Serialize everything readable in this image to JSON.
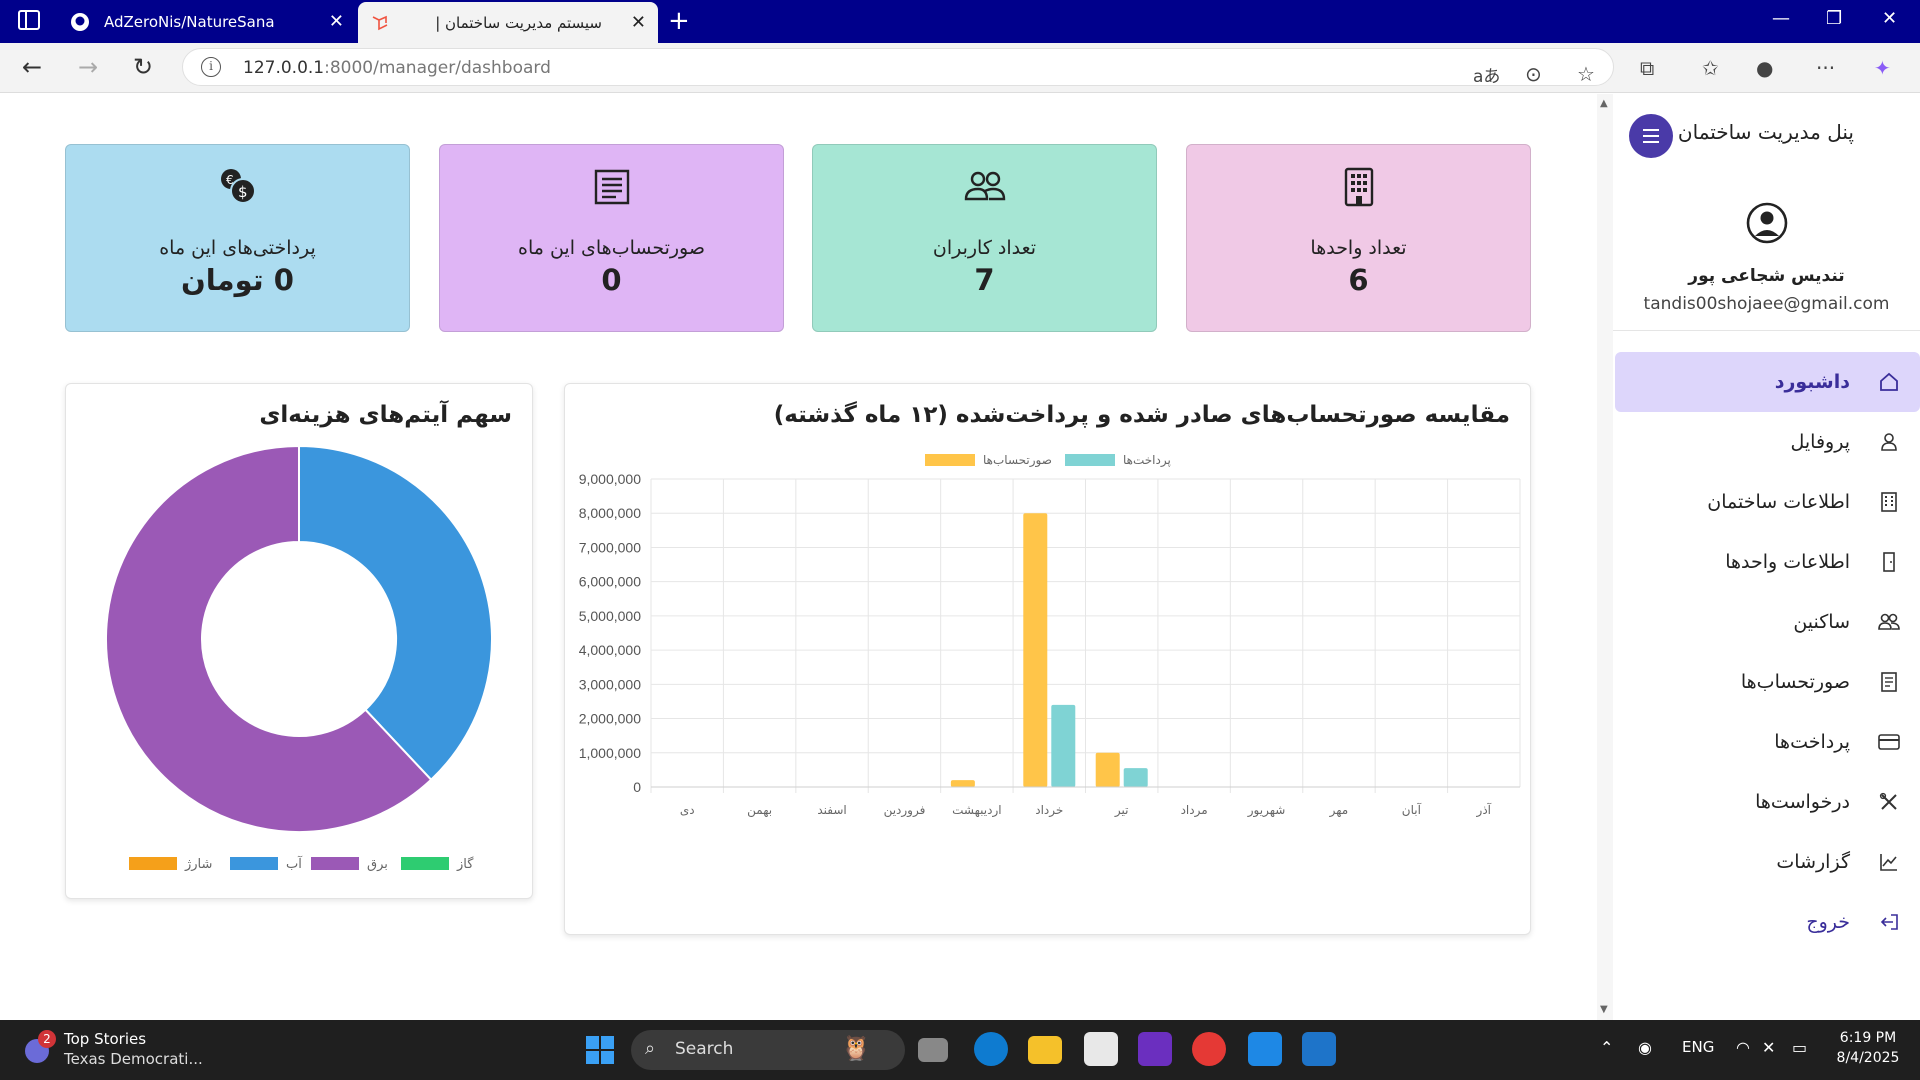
{
  "browser": {
    "tabs": [
      {
        "title": "AdZeroNis/NatureSana",
        "active": false
      },
      {
        "title": "سیستم مدیریت ساختمان |",
        "active": true
      }
    ],
    "url_host": "127.0.0.1",
    "url_path": ":8000/manager/dashboard"
  },
  "sidebar": {
    "brand": "پنل مدیریت ساختمان",
    "user_name": "تندیس شجاعی پور",
    "user_email": "tandis00shojaee@gmail.com",
    "items": [
      {
        "label": "داشبورد",
        "icon": "home-icon"
      },
      {
        "label": "پروفایل",
        "icon": "user-icon"
      },
      {
        "label": "اطلاعات ساختمان",
        "icon": "building-icon"
      },
      {
        "label": "اطلاعات واحدها",
        "icon": "door-icon"
      },
      {
        "label": "ساکنین",
        "icon": "people-icon"
      },
      {
        "label": "صورتحساب‌ها",
        "icon": "invoice-icon"
      },
      {
        "label": "پرداخت‌ها",
        "icon": "card-icon"
      },
      {
        "label": "درخواست‌ها",
        "icon": "tools-icon"
      },
      {
        "label": "گزارشات",
        "icon": "chart-icon"
      },
      {
        "label": "خروج",
        "icon": "logout-icon"
      }
    ]
  },
  "cards": {
    "units": {
      "label": "تعداد واحدها",
      "value": "6",
      "color": "#f0c9e6"
    },
    "users": {
      "label": "تعداد کاربران",
      "value": "7",
      "color": "#a6e6d4"
    },
    "invoices": {
      "label": "صورتحساب‌های این ماه",
      "value": "0",
      "color": "#dfb5f5"
    },
    "payments": {
      "label": "پرداختی‌های این ماه",
      "value": "0 تومان",
      "color": "#acdcf0"
    }
  },
  "bar_panel": {
    "title": "مقایسه صورتحساب‌های صادر شده و پرداخت‌شده (۱۲ ماه گذشته)"
  },
  "pie_panel": {
    "title": "سهم آیتم‌های هزینه‌ای"
  },
  "chart_data": [
    {
      "type": "bar",
      "categories": [
        "دی",
        "بهمن",
        "اسفند",
        "فروردین",
        "اردیبهشت",
        "خرداد",
        "تیر",
        "مرداد",
        "شهریور",
        "مهر",
        "آبان",
        "آذر"
      ],
      "series": [
        {
          "name": "صورتحساب‌ها",
          "color": "#ffc549",
          "values": [
            0,
            0,
            0,
            0,
            200000,
            8000000,
            1000000,
            0,
            0,
            0,
            0,
            0
          ]
        },
        {
          "name": "پرداخت‌ها",
          "color": "#7fd3d4",
          "values": [
            0,
            0,
            0,
            0,
            0,
            2400000,
            550000,
            0,
            0,
            0,
            0,
            0
          ]
        }
      ],
      "y_ticks": [
        "0",
        "1,000,000",
        "2,000,000",
        "3,000,000",
        "4,000,000",
        "5,000,000",
        "6,000,000",
        "7,000,000",
        "8,000,000",
        "9,000,000"
      ],
      "ylim": [
        0,
        9000000
      ],
      "legend": "top",
      "grid": true
    },
    {
      "type": "pie",
      "labels": [
        "شارژ",
        "آب",
        "برق",
        "گاز"
      ],
      "values": [
        0,
        38,
        62,
        0
      ],
      "colors": [
        "#f5a01a",
        "#3b96dd",
        "#9b59b6",
        "#2ecc71"
      ],
      "legend": "bottom"
    }
  ],
  "taskbar": {
    "news_title": "Top Stories",
    "news_sub": "Texas Democrati...",
    "news_badge": "2",
    "search": "Search",
    "lang": "ENG",
    "time": "6:19 PM",
    "date": "8/4/2025"
  }
}
